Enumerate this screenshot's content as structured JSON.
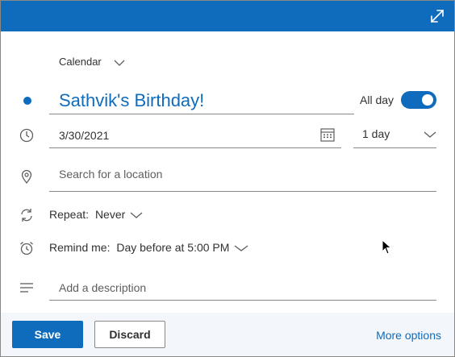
{
  "calendar": {
    "label": "Calendar"
  },
  "event": {
    "title": "Sathvik's Birthday!",
    "all_day_label": "All day",
    "all_day_enabled": true,
    "date": "3/30/2021",
    "duration": "1 day",
    "location_placeholder": "Search for a location",
    "repeat_label": "Repeat:",
    "repeat_value": "Never",
    "remind_label": "Remind me:",
    "remind_value": "Day before at 5:00 PM",
    "description_placeholder": "Add a description"
  },
  "footer": {
    "save_label": "Save",
    "discard_label": "Discard",
    "more_options_label": "More options"
  },
  "icons": {
    "expand": "expand-icon",
    "clock": "clock-icon",
    "location": "location-pin-icon",
    "repeat": "repeat-icon",
    "alarm": "alarm-clock-icon",
    "description": "text-lines-icon",
    "calendar_picker": "calendar-icon",
    "chevron": "chevron-down-icon"
  },
  "colors": {
    "accent": "#0f6cbd",
    "footer_bg": "#f3f6fb"
  }
}
